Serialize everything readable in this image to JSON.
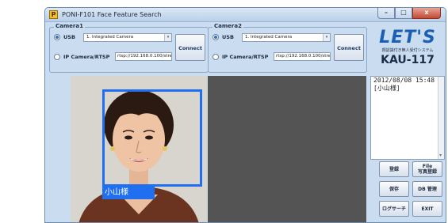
{
  "window": {
    "app_icon_letter": "P",
    "title": "PONI-F101 Face Feature Search",
    "controls": {
      "minimize": "–",
      "maximize": "□",
      "close": "x"
    }
  },
  "camera1": {
    "legend": "Camera1",
    "usb_label": "USB",
    "usb_device": "1. Integrated Camera",
    "ip_label": "IP Camera/RTSP",
    "rtsp_url": "rtsp://192.168.0.100/stre",
    "connect_label": "Connect"
  },
  "camera2": {
    "legend": "Camera2",
    "usb_label": "USB",
    "usb_device": "1. Integrated Camera",
    "ip_label": "IP Camera/RTSP",
    "rtsp_url": "rtsp://192.168.0.100/stre",
    "connect_label": "Connect"
  },
  "logo": {
    "mark": "LET'S",
    "subtitle": "顔認識付き無人受付システム",
    "model": "KAU-117"
  },
  "detection": {
    "name_tag": "小山様"
  },
  "log": {
    "lines": [
      "2012/08/08 15:48",
      "[小山様]"
    ]
  },
  "buttons": {
    "register": "登録",
    "file_line1": "File",
    "file_line2": "写真登録",
    "save": "保存",
    "db_manage": "DB 管理",
    "logger": "ログサーチ",
    "exit": "EXIT"
  },
  "colors": {
    "window_bg": "#c9dcf0",
    "face_box": "#1f6ff0",
    "logo_blue": "#1a5fb4",
    "video_empty": "#545454"
  }
}
